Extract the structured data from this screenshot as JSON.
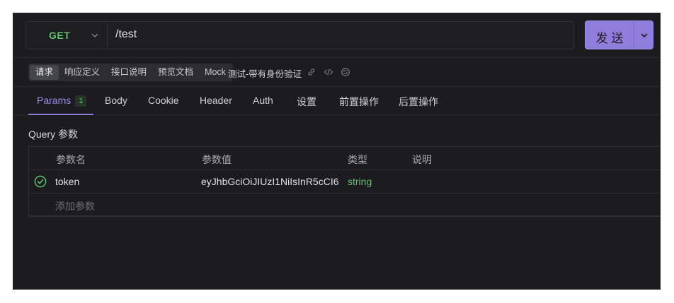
{
  "request": {
    "method": "GET",
    "path": "/test",
    "send_label": "发送"
  },
  "segments": [
    {
      "label": "请求",
      "active": true
    },
    {
      "label": "响应定义",
      "active": false
    },
    {
      "label": "接口说明",
      "active": false
    },
    {
      "label": "预览文档",
      "active": false
    },
    {
      "label": "Mock",
      "active": false
    }
  ],
  "api_name": "测试-带有身份验证",
  "toolbar_icons": [
    "link-icon",
    "code-icon",
    "sync-icon"
  ],
  "tabs": [
    {
      "label": "Params",
      "badge": "1",
      "active": true
    },
    {
      "label": "Body"
    },
    {
      "label": "Cookie"
    },
    {
      "label": "Header"
    },
    {
      "label": "Auth"
    },
    {
      "label": "设置"
    },
    {
      "label": "前置操作"
    },
    {
      "label": "后置操作"
    }
  ],
  "query": {
    "title": "Query 参数",
    "columns": [
      "参数名",
      "参数值",
      "类型",
      "说明"
    ],
    "rows": [
      {
        "enabled": true,
        "name": "token",
        "value": "eyJhbGciOiJIUzI1NiIsInR5cCI6",
        "type": "string",
        "description": ""
      }
    ],
    "add_placeholder": "添加参数"
  },
  "colors": {
    "accent": "#8f7ddb",
    "method_get": "#5fbf6a",
    "background": "#1c1c20"
  }
}
